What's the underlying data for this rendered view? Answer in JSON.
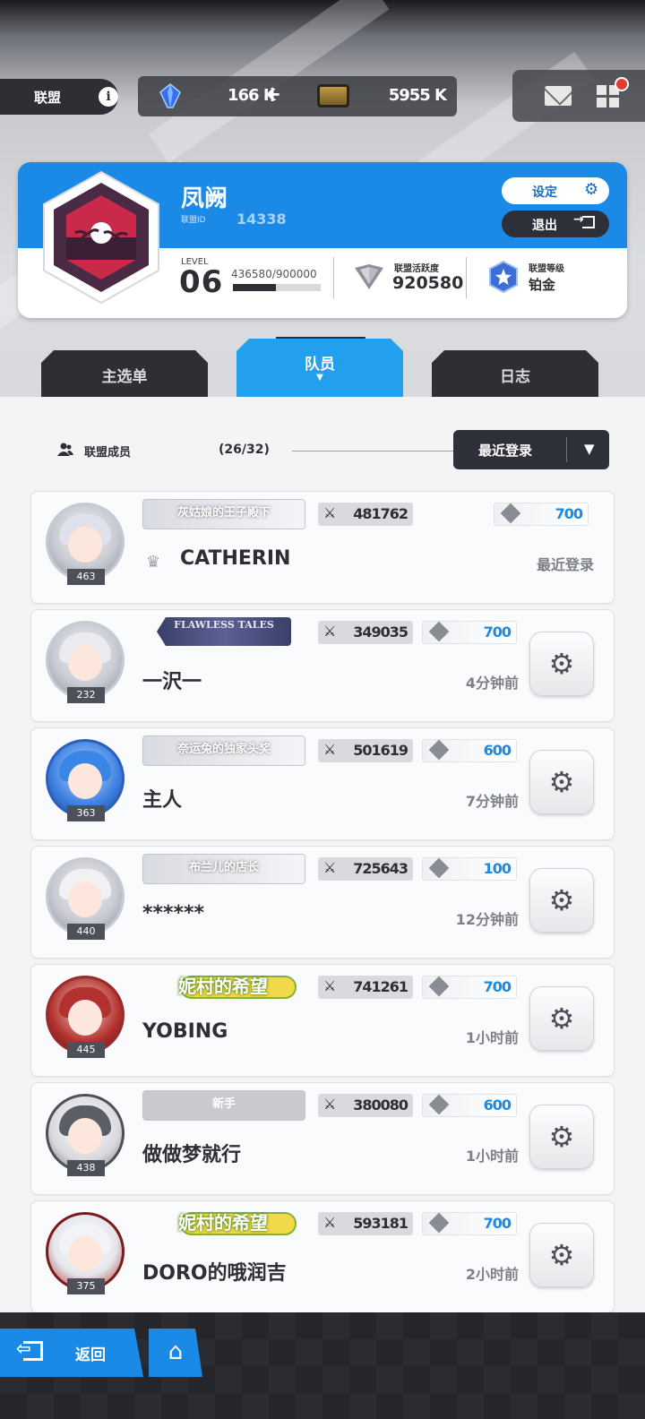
{
  "header": {
    "alliance_label": "联盟",
    "info_icon": "i",
    "gems": "166 K",
    "plus": "+",
    "tickets": "5955 K"
  },
  "union": {
    "name": "凤阙",
    "id_label": "联盟ID",
    "id": "14338",
    "settings_label": "设定",
    "exit_label": "退出",
    "level_label": "LEVEL",
    "level": "06",
    "exp": "436580/900000",
    "exp_fraction": 0.485,
    "activity_label": "联盟活跃度",
    "activity": "920580",
    "rank_label": "联盟等级",
    "rank": "铂金"
  },
  "tabs": [
    {
      "label": "主选单"
    },
    {
      "label": "队员"
    },
    {
      "label": "日志"
    }
  ],
  "members_header": {
    "label": "联盟成员",
    "count": "(26/32)",
    "sort": "最近登录"
  },
  "members": [
    {
      "title": "灰姑娘的王子殿下",
      "power": "481762",
      "contrib": "700",
      "name": "CATHERIN",
      "login": "最近登录",
      "level": "463"
    },
    {
      "title": "FLAWLESS TALES",
      "power": "349035",
      "contrib": "700",
      "name": "一沢一",
      "login": "4分钟前",
      "level": "232"
    },
    {
      "title": "奈运兔的独家头奖",
      "power": "501619",
      "contrib": "600",
      "name": "主人",
      "login": "7分钟前",
      "level": "363"
    },
    {
      "title": "布兰儿的店长",
      "power": "725643",
      "contrib": "100",
      "name": "******",
      "login": "12分钟前",
      "level": "440"
    },
    {
      "title": "妮村的希望",
      "power": "741261",
      "contrib": "700",
      "name": "YOBING",
      "login": "1小时前",
      "level": "445"
    },
    {
      "title": "新手",
      "power": "380080",
      "contrib": "600",
      "name": "做做梦就行",
      "login": "1小时前",
      "level": "438"
    },
    {
      "title": "妮村的希望",
      "power": "593181",
      "contrib": "700",
      "name": "DORO的哦润吉",
      "login": "2小时前",
      "level": "375"
    }
  ],
  "footer": {
    "back_label": "返回"
  },
  "colors": {
    "accent": "#1b8ae6",
    "dark": "#2d2f34",
    "contribution": "#1b8ae6"
  }
}
